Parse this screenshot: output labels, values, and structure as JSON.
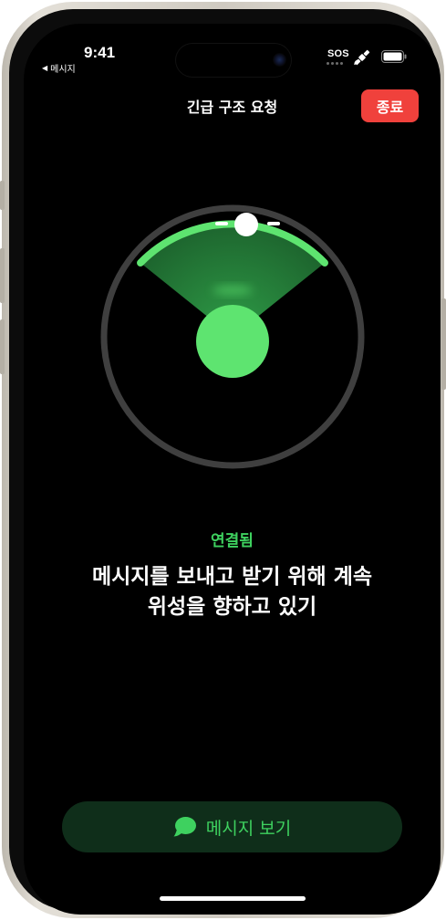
{
  "status_bar": {
    "time": "9:41",
    "back_app": "메시지",
    "sos": "SOS"
  },
  "header": {
    "title": "긴급 구조 요청",
    "end_label": "종료"
  },
  "radar": {
    "icons": [
      "satellite-indicator-icon",
      "target-circle-icon"
    ]
  },
  "status": {
    "connection": "연결됨",
    "instruction_line1": "메시지를 보내고 받기 위해 계속",
    "instruction_line2": "위성을 향하고 있기"
  },
  "footer": {
    "view_messages_label": "메시지 보기"
  },
  "colors": {
    "accent_green": "#3ed15f",
    "end_red": "#f0413c",
    "ring_gray": "#3f3f3f",
    "button_bg": "#0f2e1a"
  }
}
